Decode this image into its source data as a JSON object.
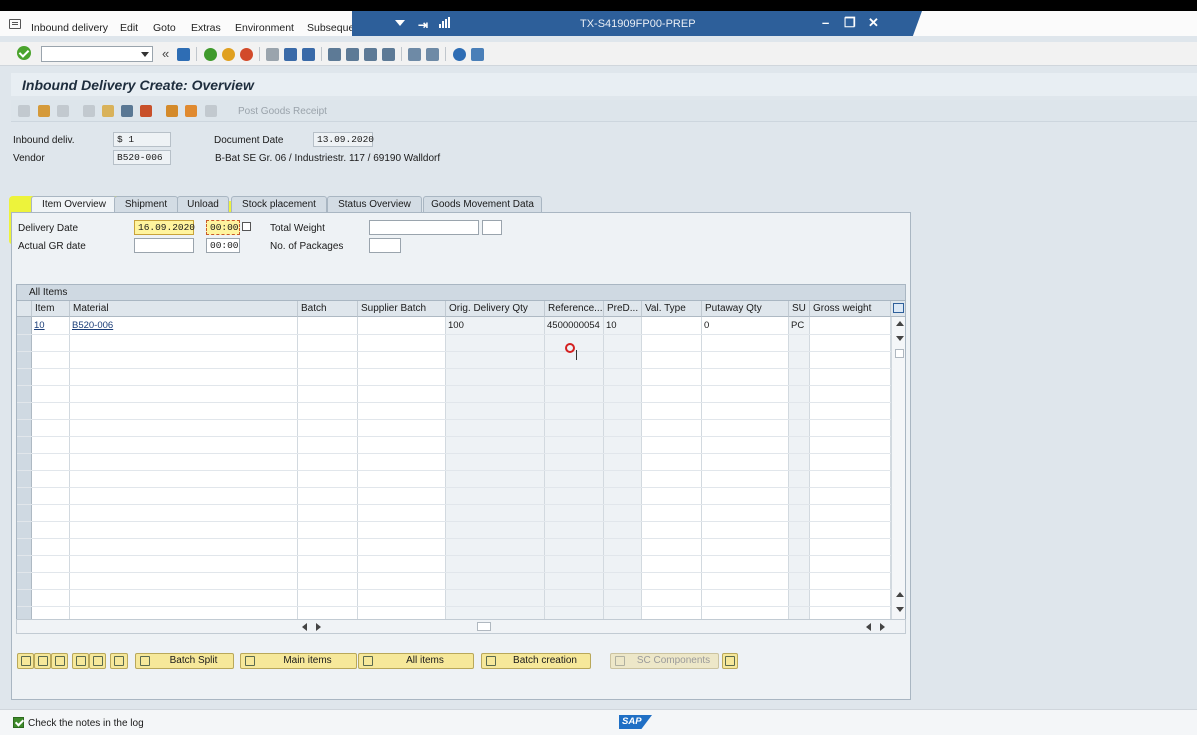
{
  "menu": {
    "items": [
      "Inbound delivery",
      "Edit",
      "Goto",
      "Extras",
      "Environment",
      "Subsequent"
    ]
  },
  "titlebar": {
    "system": "TX-S41909FP00-PREP"
  },
  "page": {
    "title": "Inbound Delivery  Create: Overview",
    "post_goods_receipt": "Post Goods Receipt"
  },
  "header": {
    "inbound_deliv_label": "Inbound deliv.",
    "inbound_deliv_value": "$          1",
    "document_date_label": "Document Date",
    "document_date_value": "13.09.2020",
    "vendor_label": "Vendor",
    "vendor_value": "B520-006",
    "vendor_address": "B-Bat SE Gr. 06 / Industriestr. 117 / 69190 Walldorf"
  },
  "tabs": [
    "Item Overview",
    "Shipment",
    "Unload",
    "Stock placement",
    "Status Overview",
    "Goods Movement Data"
  ],
  "item_overview": {
    "delivery_date_label": "Delivery Date",
    "delivery_date_value": "16.09.2020",
    "delivery_time_value": "00:00",
    "actual_gr_label": "Actual GR date",
    "actual_gr_value": "",
    "actual_gr_time": "00:00",
    "total_weight_label": "Total Weight",
    "packages_label": "No. of Packages"
  },
  "table": {
    "title": "All Items",
    "columns": [
      "Item",
      "Material",
      "Batch",
      "Supplier Batch",
      "Orig. Delivery Qty",
      "Reference...",
      "PreD...",
      "Val. Type",
      "Putaway Qty",
      "SU",
      "Gross weight"
    ],
    "rows": [
      {
        "item": "10",
        "material": "B520-006",
        "batch": "",
        "supplier_batch": "",
        "orig_qty": "100",
        "reference": "4500000054",
        "pred": "10",
        "val_type": "",
        "putaway_qty": "0",
        "su": "PC",
        "gross_weight": ""
      }
    ]
  },
  "buttons": {
    "batch_split": "Batch Split",
    "main_items": "Main items",
    "all_items": "All items",
    "batch_creation": "Batch creation",
    "sc_components": "SC Components"
  },
  "status": {
    "message": "Check the notes in the log",
    "logo": "SAP"
  },
  "colors": {
    "title_strip": "#2d5f9a",
    "highlight": "#f0f514",
    "button_bg": "#f6e89a",
    "screen_bg": "#dfe6ec"
  }
}
